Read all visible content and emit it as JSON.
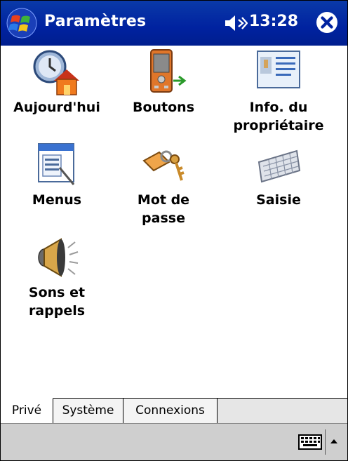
{
  "titlebar": {
    "start_icon": "windows-flag-icon",
    "title": "Paramètres",
    "volume_icon": "speaker-icon",
    "time": "13:28",
    "close_icon": "close-icon"
  },
  "tiles": [
    {
      "label_line1": "Aujourd'hui",
      "label_line2": "",
      "icon": "today-clock-house-icon"
    },
    {
      "label_line1": "Boutons",
      "label_line2": "",
      "icon": "buttons-device-icon"
    },
    {
      "label_line1": "Info. du",
      "label_line2": "propriétaire",
      "icon": "owner-info-card-icon"
    },
    {
      "label_line1": "Menus",
      "label_line2": "",
      "icon": "menus-window-icon"
    },
    {
      "label_line1": "Mot de",
      "label_line2": "passe",
      "icon": "password-keys-icon"
    },
    {
      "label_line1": "Saisie",
      "label_line2": "",
      "icon": "keyboard-input-icon"
    },
    {
      "label_line1": "Sons et",
      "label_line2": "rappels",
      "icon": "sounds-speaker-icon"
    }
  ],
  "tabs": [
    {
      "label": "Privé",
      "active": true
    },
    {
      "label": "Système",
      "active": false
    },
    {
      "label": "Connexions",
      "active": false
    }
  ],
  "command_bar": {
    "input_icon": "keyboard-icon",
    "sip_menu_icon": "up-arrow-icon"
  },
  "colors": {
    "titlebar": "#0022a0",
    "tabbar": "#e6e6e6",
    "command_bar": "#cfcfcf"
  }
}
